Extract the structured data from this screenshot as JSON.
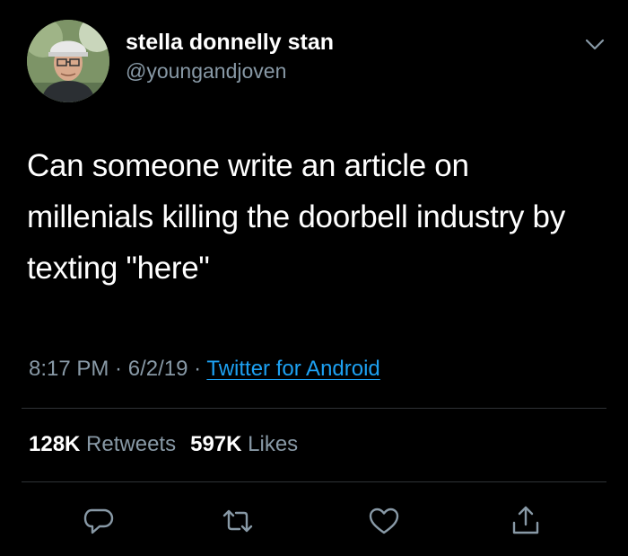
{
  "user": {
    "display_name": "stella donnelly stan",
    "handle": "@youngandjoven"
  },
  "tweet": {
    "text": "Can someone write an article on millenials killing the doorbell industry by texting \"here\"",
    "time": "8:17 PM",
    "separator": " · ",
    "date": "6/2/19",
    "source": "Twitter for Android"
  },
  "stats": {
    "retweets_count": "128K",
    "retweets_label": "Retweets",
    "likes_count": "597K",
    "likes_label": "Likes"
  },
  "icons": {
    "menu": "chevron-down-icon",
    "reply": "reply-icon",
    "retweet": "retweet-icon",
    "like": "heart-icon",
    "share": "share-icon"
  },
  "colors": {
    "background": "#000000",
    "secondary_text": "#8899a6",
    "link": "#1da1f2",
    "divider": "#2f3336"
  }
}
